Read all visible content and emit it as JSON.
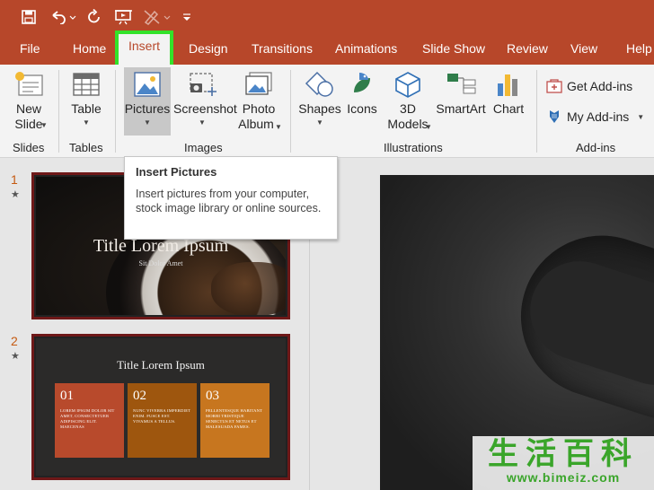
{
  "colors": {
    "accent": "#b7472a",
    "highlight": "#33e22a",
    "slide_number": "#c55a11"
  },
  "quick_access": {
    "save_icon": "save-icon",
    "undo_icon": "undo-icon",
    "redo_icon": "redo-icon",
    "present_icon": "present-from-beginning-icon",
    "pen_icon": "pen-icon",
    "customize_icon": "customize-toolbar-icon"
  },
  "tabs": [
    {
      "label": "File"
    },
    {
      "label": "Home"
    },
    {
      "label": "Insert",
      "active": true
    },
    {
      "label": "Design"
    },
    {
      "label": "Transitions"
    },
    {
      "label": "Animations"
    },
    {
      "label": "Slide Show"
    },
    {
      "label": "Review"
    },
    {
      "label": "View"
    },
    {
      "label": "Help"
    }
  ],
  "ribbon": {
    "slides": {
      "new_slide_line1": "New",
      "new_slide_line2": "Slide",
      "group": "Slides"
    },
    "tables": {
      "table": "Table",
      "group": "Tables"
    },
    "images": {
      "pictures": "Pictures",
      "screenshot": "Screenshot",
      "photo_album_line1": "Photo",
      "photo_album_line2": "Album",
      "group": "Images"
    },
    "illustrations": {
      "shapes": "Shapes",
      "icons": "Icons",
      "models_line1": "3D",
      "models_line2": "Models",
      "smartart": "SmartArt",
      "chart": "Chart",
      "group": "Illustrations"
    },
    "addins": {
      "get": "Get Add-ins",
      "my": "My Add-ins",
      "group": "Add-ins"
    }
  },
  "tooltip": {
    "title": "Insert Pictures",
    "body": "Insert pictures from your computer, stock image library or online sources."
  },
  "slides": [
    {
      "number": "1",
      "marker": "★",
      "title": "Title Lorem Ipsum",
      "subtitle": "Sit Dolor Amet"
    },
    {
      "number": "2",
      "marker": "★",
      "title": "Title Lorem Ipsum",
      "cards": [
        {
          "num": "01",
          "text": "Lorem ipsum dolor sit amet, consectetuer adipiscing elit. Maecenas",
          "color": "#b84a2c"
        },
        {
          "num": "02",
          "text": "Nunc viverra imperdiet enim. Fusce est. Vivamus a tellus.",
          "color": "#9e560e"
        },
        {
          "num": "03",
          "text": "Pellentesque habitant morbi tristique senectus et netus et malesuada fames.",
          "color": "#c7761f"
        }
      ]
    }
  ],
  "watermark": {
    "chinese": "生活百科",
    "url": "www.bimeiz.com"
  }
}
